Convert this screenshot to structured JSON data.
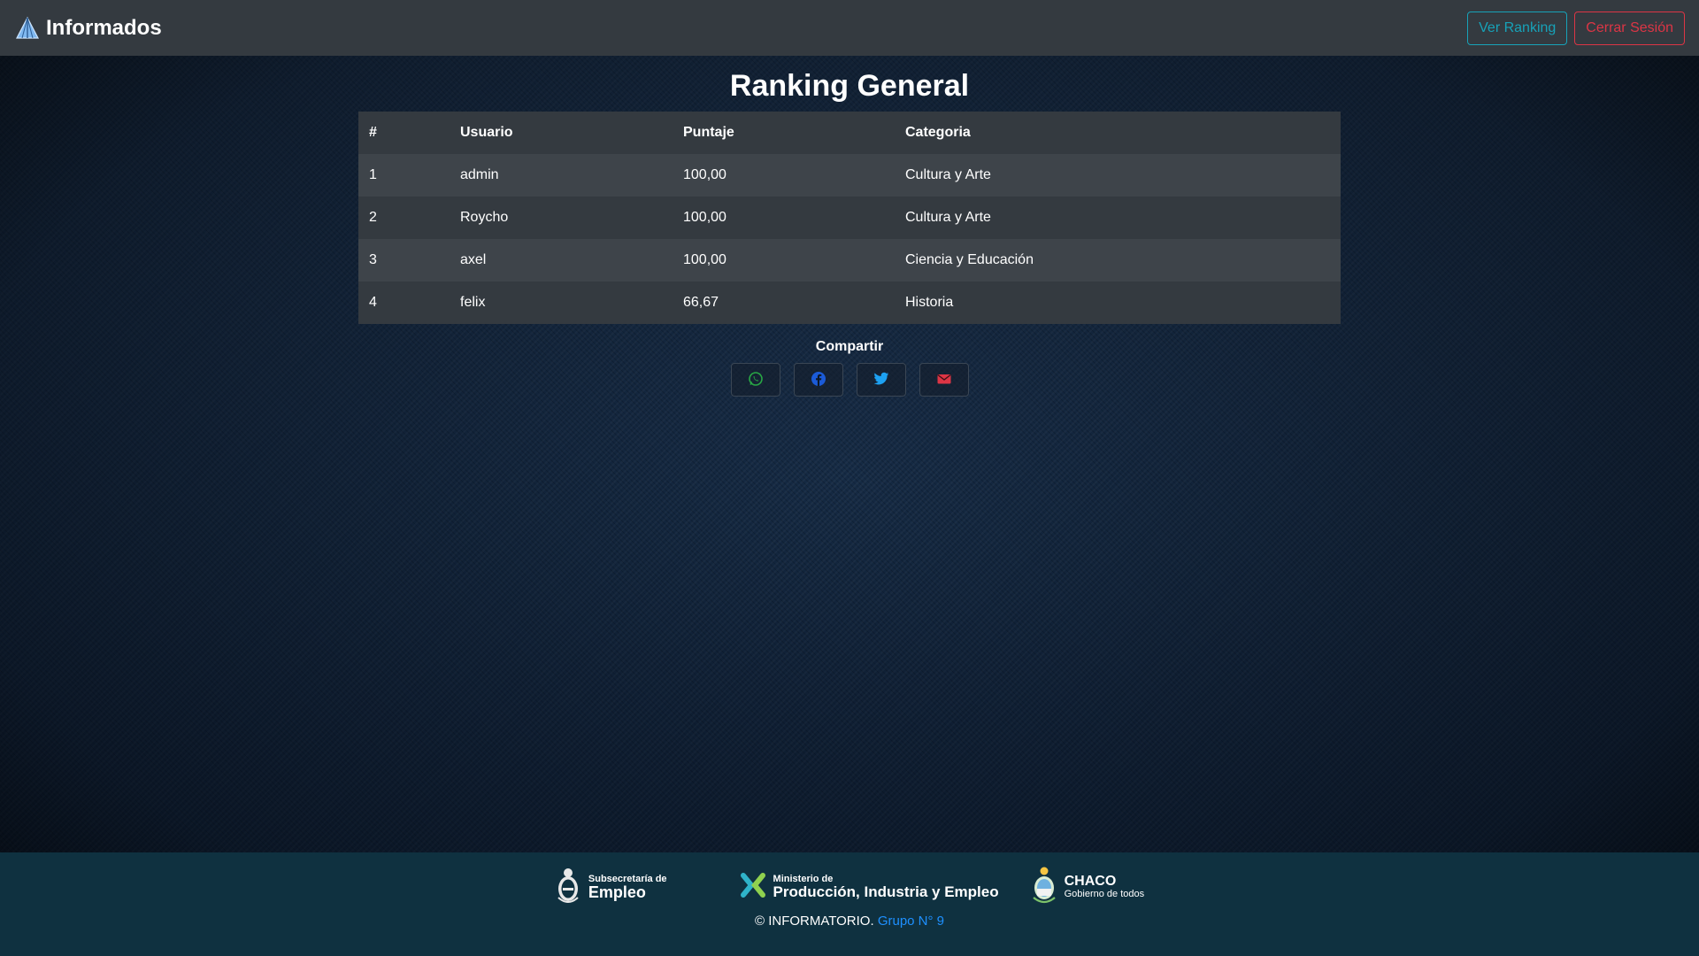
{
  "navbar": {
    "brand": "Informados",
    "ranking_button": "Ver Ranking",
    "logout_button": "Cerrar Sesión"
  },
  "main": {
    "title": "Ranking General",
    "table": {
      "headers": [
        "#",
        "Usuario",
        "Puntaje",
        "Categoria"
      ],
      "rows": [
        [
          "1",
          "admin",
          "100,00",
          "Cultura y Arte"
        ],
        [
          "2",
          "Roycho",
          "100,00",
          "Cultura y Arte"
        ],
        [
          "3",
          "axel",
          "100,00",
          "Ciencia y Educación"
        ],
        [
          "4",
          "felix",
          "66,67",
          "Historia"
        ]
      ]
    },
    "share": {
      "title": "Compartir",
      "buttons": [
        {
          "icon": "whatsapp-icon",
          "color": "#28a745"
        },
        {
          "icon": "facebook-icon",
          "color": "#1b5bd8"
        },
        {
          "icon": "twitter-icon",
          "color": "#1da1f2"
        },
        {
          "icon": "email-icon",
          "color": "#dc3545"
        }
      ]
    }
  },
  "footer": {
    "logo1": {
      "small": "Subsecretaría de",
      "big": "Empleo"
    },
    "logo2": {
      "small": "Ministerio de",
      "big": "Producción, Industria y Empleo"
    },
    "logo3": {
      "big": "CHACO",
      "small": "Gobierno de todos"
    },
    "copyright": "© INFORMATORIO.",
    "group_link": "Grupo N° 9"
  },
  "colors": {
    "navbar_bg": "#343a40",
    "info": "#17a2b8",
    "danger": "#dc3545",
    "footer_bg": "#0f3140",
    "link": "#1e90ff"
  }
}
